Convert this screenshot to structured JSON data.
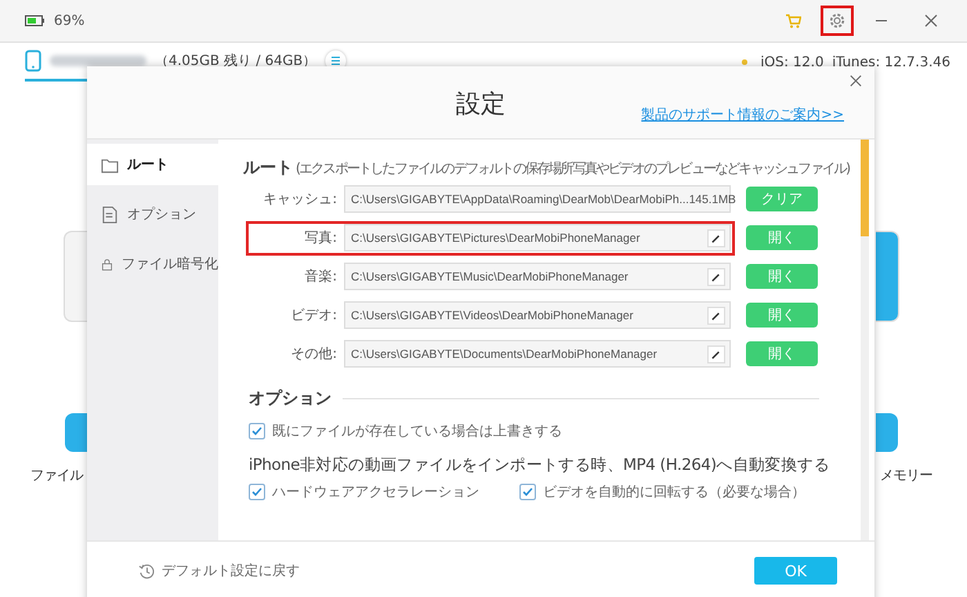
{
  "status_bar": {
    "battery": "69%"
  },
  "device": {
    "storage": "（4.05GB 残り / 64GB）",
    "ios": "iOS: 12.0",
    "itunes": "iTunes: 12.7.3.46"
  },
  "background_tiles": {
    "left": [
      "ファイル"
    ],
    "right": [
      "メモリー"
    ]
  },
  "dialog": {
    "title": "設定",
    "support_link": "製品のサポート情報のご案内>>",
    "sidebar": [
      {
        "label": "ルート",
        "selected": true
      },
      {
        "label": "オプション",
        "selected": false
      },
      {
        "label": "ファイル暗号化",
        "selected": false
      }
    ],
    "route": {
      "title": "ルート",
      "note": "(エクスポートしたファイルのデフォルトの保存場所写真やビデオのプレビューなどキャッシュファイル)",
      "rows": [
        {
          "kind": "cache",
          "label": "キャッシュ:",
          "path": "C:\\Users\\GIGABYTE\\AppData\\Roaming\\DearMob\\DearMobiPh...",
          "size": "145.1MB",
          "button": "クリア",
          "highlighted": false
        },
        {
          "kind": "path",
          "label": "写真:",
          "path": "C:\\Users\\GIGABYTE\\Pictures\\DearMobiPhoneManager",
          "button": "開く",
          "highlighted": true
        },
        {
          "kind": "path",
          "label": "音楽:",
          "path": "C:\\Users\\GIGABYTE\\Music\\DearMobiPhoneManager",
          "button": "開く",
          "highlighted": false
        },
        {
          "kind": "path",
          "label": "ビデオ:",
          "path": "C:\\Users\\GIGABYTE\\Videos\\DearMobiPhoneManager",
          "button": "開く",
          "highlighted": false
        },
        {
          "kind": "path",
          "label": "その他:",
          "path": "C:\\Users\\GIGABYTE\\Documents\\DearMobiPhoneManager",
          "button": "開く",
          "highlighted": false
        }
      ]
    },
    "options": {
      "title": "オプション",
      "overwrite": {
        "label": "既にファイルが存在している場合は上書きする",
        "checked": true
      },
      "convert_text": "iPhone非対応の動画ファイルをインポートする時、MP4 (H.264)へ自動変換する",
      "convert_options": [
        {
          "label": "ハードウェアアクセラレーション",
          "checked": true
        },
        {
          "label": "ビデオを自動的に回転する（必要な場合）",
          "checked": true
        }
      ]
    },
    "reset": "デフォルト設定に戻す",
    "ok": "OK"
  }
}
